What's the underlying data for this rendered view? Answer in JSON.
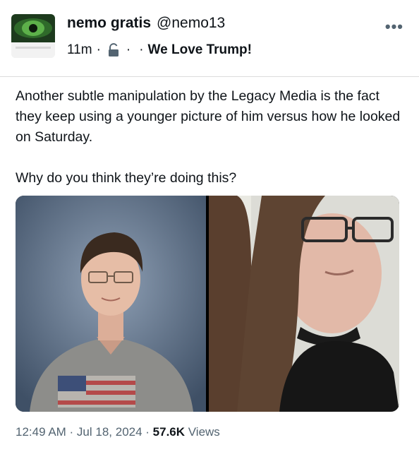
{
  "author": {
    "display_name": "nemo gratis",
    "handle": "@nemo13",
    "avatar_icon": "green-eye-avatar"
  },
  "meta": {
    "time_ago": "11m",
    "separator": "·",
    "privacy_icon": "lock-icon",
    "community": "We Love Trump!"
  },
  "more_label": "•••",
  "post": {
    "paragraph_1": "Another subtle manipulation by the Legacy Media is the fact they keep using a younger picture of him versus how he looked on Saturday.",
    "paragraph_2": "Why do you think they’re doing this?"
  },
  "media": {
    "left_photo": "school-portrait-photo",
    "right_photo": "selfie-photo"
  },
  "footer": {
    "timestamp": "12:49 AM · Jul 18, 2024 · ",
    "views_count": "57.6K",
    "views_label": " Views"
  },
  "colors": {
    "text": "#0f1419",
    "secondary": "#536471",
    "divider": "#dcdcdc"
  }
}
